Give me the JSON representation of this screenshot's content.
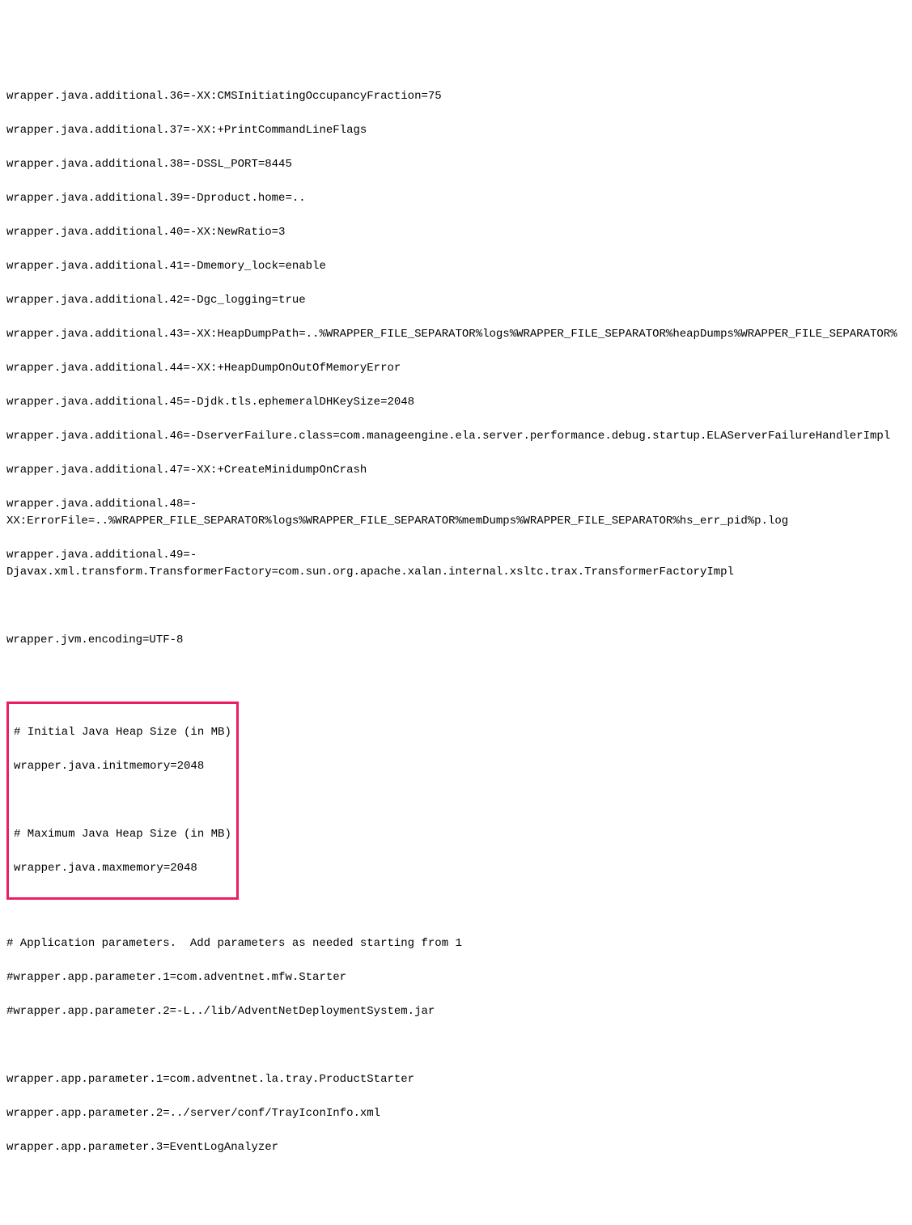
{
  "lines": {
    "l1": "wrapper.java.additional.36=-XX:CMSInitiatingOccupancyFraction=75",
    "l2": "wrapper.java.additional.37=-XX:+PrintCommandLineFlags",
    "l3": "wrapper.java.additional.38=-DSSL_PORT=8445",
    "l4": "wrapper.java.additional.39=-Dproduct.home=..",
    "l5": "wrapper.java.additional.40=-XX:NewRatio=3",
    "l6": "wrapper.java.additional.41=-Dmemory_lock=enable",
    "l7": "wrapper.java.additional.42=-Dgc_logging=true",
    "l8": "wrapper.java.additional.43=-XX:HeapDumpPath=..%WRAPPER_FILE_SEPARATOR%logs%WRAPPER_FILE_SEPARATOR%heapDumps%WRAPPER_FILE_SEPARATOR%",
    "l9": "wrapper.java.additional.44=-XX:+HeapDumpOnOutOfMemoryError",
    "l10": "wrapper.java.additional.45=-Djdk.tls.ephemeralDHKeySize=2048",
    "l11": "wrapper.java.additional.46=-DserverFailure.class=com.manageengine.ela.server.performance.debug.startup.ELAServerFailureHandlerImpl",
    "l12": "wrapper.java.additional.47=-XX:+CreateMinidumpOnCrash",
    "l13": "wrapper.java.additional.48=-XX:ErrorFile=..%WRAPPER_FILE_SEPARATOR%logs%WRAPPER_FILE_SEPARATOR%memDumps%WRAPPER_FILE_SEPARATOR%hs_err_pid%p.log",
    "l14": "wrapper.java.additional.49=-Djavax.xml.transform.TransformerFactory=com.sun.org.apache.xalan.internal.xsltc.trax.TransformerFactoryImpl",
    "l15": "wrapper.jvm.encoding=UTF-8",
    "h1": "# Initial Java Heap Size (in MB)",
    "h2": "wrapper.java.initmemory=2048",
    "h3": "# Maximum Java Heap Size (in MB)",
    "h4": "wrapper.java.maxmemory=2048",
    "l16": "# Application parameters.  Add parameters as needed starting from 1",
    "l17": "#wrapper.app.parameter.1=com.adventnet.mfw.Starter",
    "l18": "#wrapper.app.parameter.2=-L../lib/AdventNetDeploymentSystem.jar",
    "l19": "wrapper.app.parameter.1=com.adventnet.la.tray.ProductStarter",
    "l20": "wrapper.app.parameter.2=../server/conf/TrayIconInfo.xml",
    "l21": "wrapper.app.parameter.3=EventLogAnalyzer"
  }
}
